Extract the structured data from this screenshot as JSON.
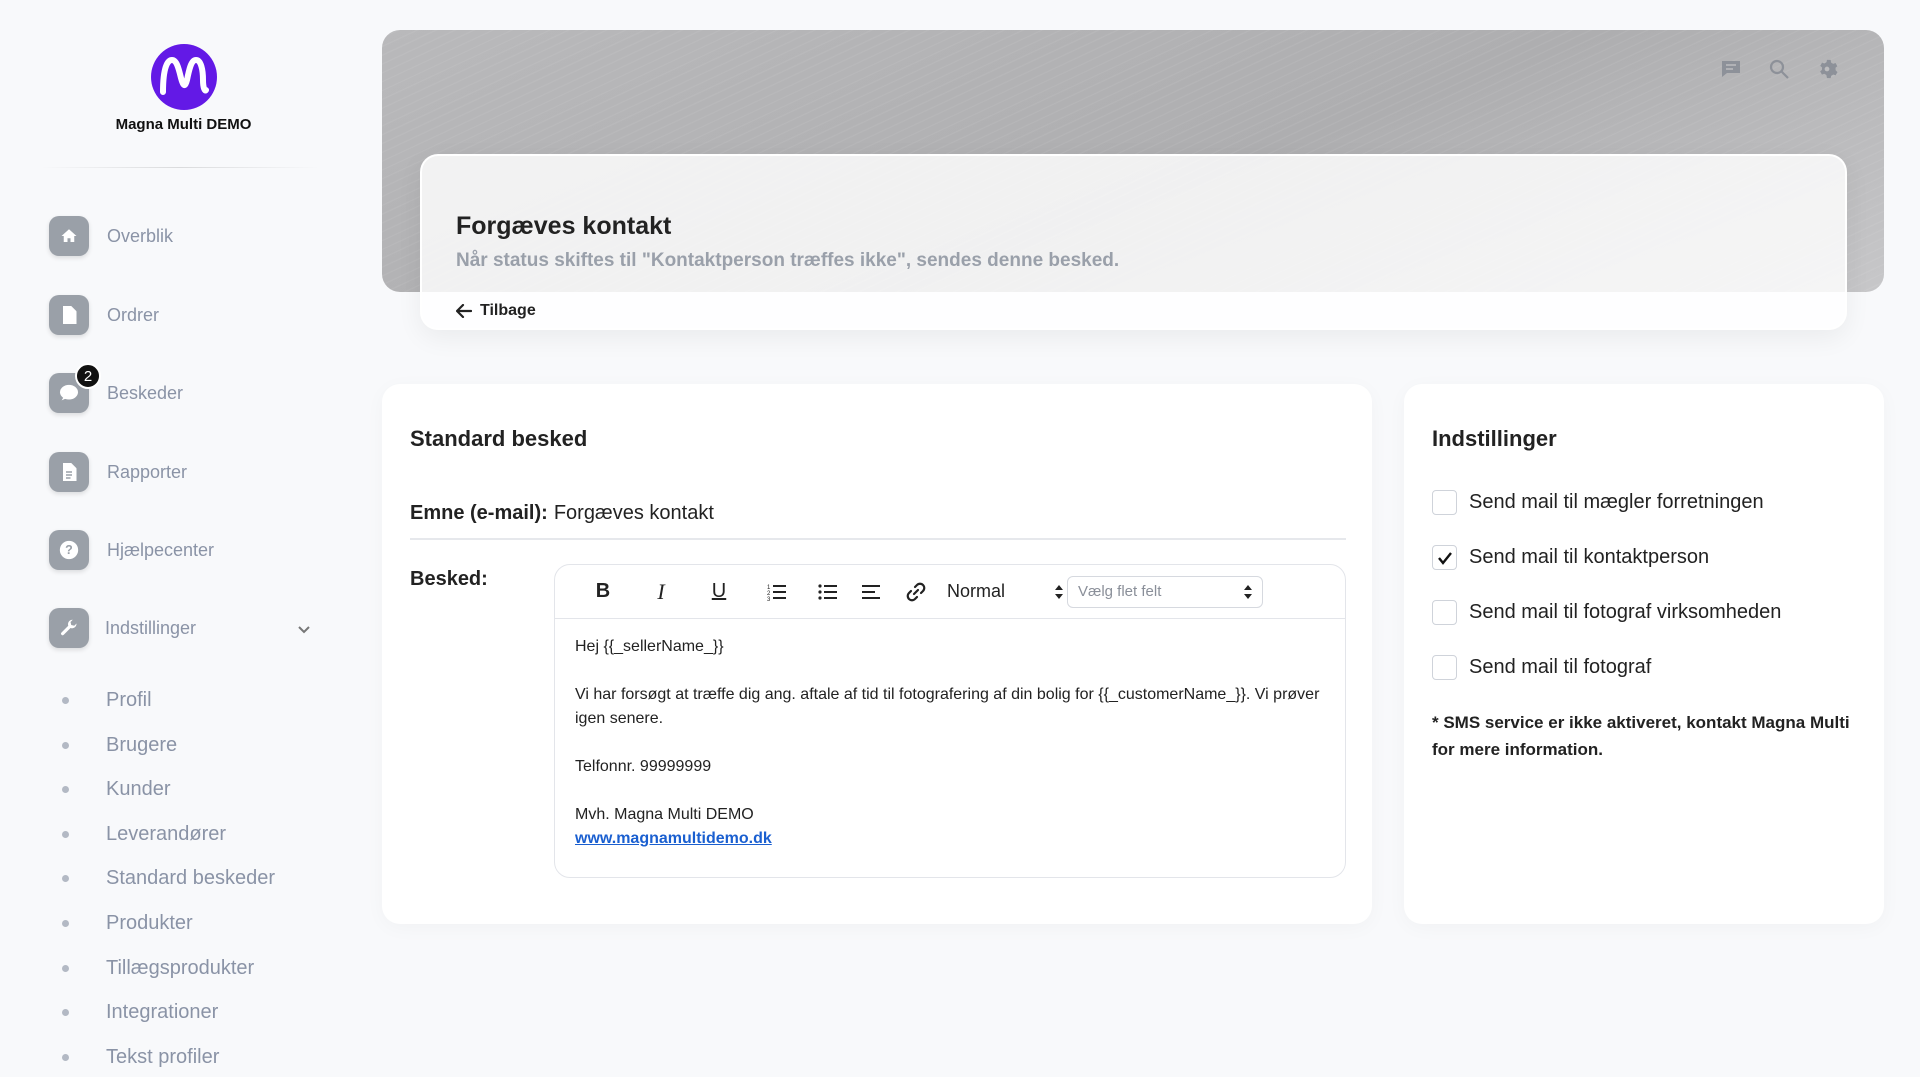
{
  "brand": {
    "name": "Magna Multi DEMO",
    "logo_color": "#6319e6"
  },
  "sidebar": {
    "items": [
      {
        "label": "Overblik",
        "icon": "home-icon"
      },
      {
        "label": "Ordrer",
        "icon": "document-icon"
      },
      {
        "label": "Beskeder",
        "icon": "chat-icon",
        "badge": "2"
      },
      {
        "label": "Rapporter",
        "icon": "report-icon"
      },
      {
        "label": "Hjælpecenter",
        "icon": "help-icon"
      },
      {
        "label": "Indstillinger",
        "icon": "wrench-icon",
        "expanded": true
      }
    ],
    "sub_items": [
      "Profil",
      "Brugere",
      "Kunder",
      "Leverandører",
      "Standard beskeder",
      "Produkter",
      "Tillægsprodukter",
      "Integrationer",
      "Tekst profiler"
    ]
  },
  "topbar": {
    "icons": [
      "message-icon",
      "search-icon",
      "gear-icon"
    ]
  },
  "header": {
    "title": "Forgæves kontakt",
    "subtitle": "Når status skiftes til \"Kontaktperson træffes ikke\", sendes denne besked.",
    "back_label": "Tilbage"
  },
  "message_card": {
    "title": "Standard besked",
    "subject_label": "Emne (e-mail):",
    "subject_value": "Forgæves kontakt",
    "message_label": "Besked:",
    "toolbar": {
      "bold": "B",
      "italic": "I",
      "underline": "U",
      "format_select": "Normal",
      "merge_field_placeholder": "Vælg flet felt"
    },
    "body": {
      "greeting": "Hej {{_sellerName_}}",
      "paragraph": "Vi har forsøgt at træffe dig ang. aftale af tid til fotografering af din bolig for {{_customerName_}}. Vi prøver igen senere.",
      "phone": "Telfonnr. 99999999",
      "signoff": "Mvh. Magna Multi DEMO",
      "link": "www.magnamultidemo.dk"
    }
  },
  "settings_card": {
    "title": "Indstillinger",
    "options": [
      {
        "label": "Send mail til mægler forretningen",
        "checked": false
      },
      {
        "label": "Send mail til kontaktperson",
        "checked": true
      },
      {
        "label": "Send mail til fotograf virksomheden",
        "checked": false
      },
      {
        "label": "Send mail til fotograf",
        "checked": false
      }
    ],
    "note": "* SMS service er ikke aktiveret, kontakt Magna Multi for mere information."
  }
}
